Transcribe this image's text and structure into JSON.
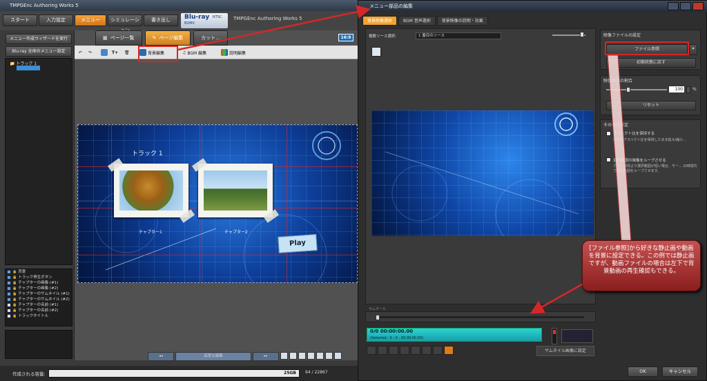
{
  "app": {
    "title": "TMPGEnc Authoring Works 5",
    "top_nav": [
      "スタート",
      "入力設定",
      "メニュー",
      "シミュレーション",
      "書き出し"
    ],
    "format": "Blu-ray",
    "format_sub": "BDMV",
    "standard": "NTSC",
    "product": "TMPGEnc Authoring Works 5"
  },
  "left": {
    "wizard_button": "メニュー作成ウィザードを実行",
    "bluray_settings_button": "Blu-ray 全体のメニュー設定",
    "tree": {
      "track": "トラック 1"
    },
    "parts": [
      {
        "icon": "image",
        "label": "背景"
      },
      {
        "icon": "image",
        "label": "トラック再生ボタン"
      },
      {
        "icon": "image",
        "label": "チャプターの画像 (#1)"
      },
      {
        "icon": "image",
        "label": "チャプターの画像 (#2)"
      },
      {
        "icon": "image",
        "label": "チャプターのサムネイル (#1)"
      },
      {
        "icon": "image",
        "label": "チャプターのサムネイル (#2)"
      },
      {
        "icon": "text",
        "label": "チャプターの名前 (#1)"
      },
      {
        "icon": "text",
        "label": "チャプターの名前 (#2)"
      },
      {
        "icon": "text",
        "label": "トラックタイトル"
      }
    ]
  },
  "center": {
    "tabs": [
      "ページ一覧",
      "ページ編集",
      "カット..."
    ],
    "toolbar": {
      "bg_edit": "背景編集",
      "bgm_edit": "BGM 編集",
      "desc_edit": "説明編集"
    },
    "ratio_badge": "16:9",
    "canvas": {
      "track_title": "トラック 1",
      "chapter1": "チャプター1",
      "chapter2": "チャプター2",
      "play": "Play"
    },
    "nav_middle": "高度な編集"
  },
  "status": {
    "label": "作成される容量:",
    "capacity": "25GB",
    "counter": "94 / 22867"
  },
  "dialog": {
    "title": "メニュー部品の編集",
    "tabs": [
      "背景映像選択",
      "BGM 音声選択",
      "背景映像の説明・効果"
    ],
    "source_label": "複数ソース選択:",
    "source_value": "1 番目のソース",
    "file_section": "映像ファイルの設定",
    "file_browse": "ファイル参照",
    "reset_initial": "初期状態に戻す",
    "display_ratio_section": "映像表示の割合",
    "ratio_value": "100",
    "ratio_unit": "%",
    "ratio_fraction": 0.35,
    "reset": "リセット",
    "other_section": "その他の設定",
    "aspect_opt": "アスペクト比を保持する",
    "aspect_desc": "映像のアスペクト比を保持したまま拡大/縮小...",
    "loop_opt": "選択範囲の映像をループさせる",
    "loop_desc": "カット時間より選択範囲が短い場合、モー... の時間内で選択範囲をループさせます。",
    "seek_label": "サムネール",
    "timecode": "0/0  00:00:00.00",
    "timecode_sub": "(Selected : 0 - 0 : 00:00:00.03)",
    "set_thumb": "サムネイル画像に設定",
    "ok": "OK",
    "cancel": "キャンセル"
  },
  "annotation": "[ファイル参照]から好きな静止画や動画を背景に設定できる。この例では静止画ですが、動画ファイルの場合は左下で背景動画の再生確認もできる。",
  "colors": {
    "accent": "#f2a32f",
    "annotation_bg": "#b03636",
    "highlight": "#d42828",
    "timecode_bg": "#22c3c9"
  }
}
